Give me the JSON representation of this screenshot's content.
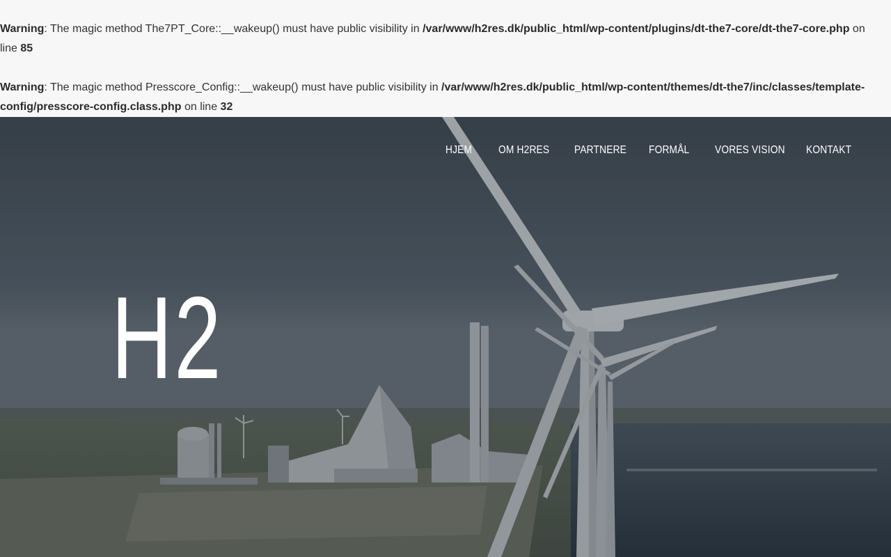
{
  "warnings": [
    {
      "label": "Warning",
      "message": ": The magic method The7PT_Core::__wakeup() must have public visibility in ",
      "path": "/var/www/h2res.dk/public_html/wp-content/plugins/dt-the7-core/dt-the7-core.php",
      "line_text": " on line ",
      "line": "85"
    },
    {
      "label": "Warning",
      "message": ": The magic method Presscore_Config::__wakeup() must have public visibility in ",
      "path": "/var/www/h2res.dk/public_html/wp-content/themes/dt-the7/inc/classes/template-config/presscore-config.class.php",
      "line_text": " on line ",
      "line": "32"
    }
  ],
  "nav": {
    "items": [
      {
        "label": "HJEM"
      },
      {
        "label": "OM H2RES"
      },
      {
        "label": "PARTNERE"
      },
      {
        "label": "FORMÅL"
      },
      {
        "label": "VORES VISION"
      },
      {
        "label": "KONTAKT"
      }
    ]
  },
  "hero": {
    "title": "H2"
  },
  "colors": {
    "sky": "#4b5560",
    "sea": "#34404c",
    "land": "#5b6353",
    "turbine": "#c9ccd0"
  }
}
